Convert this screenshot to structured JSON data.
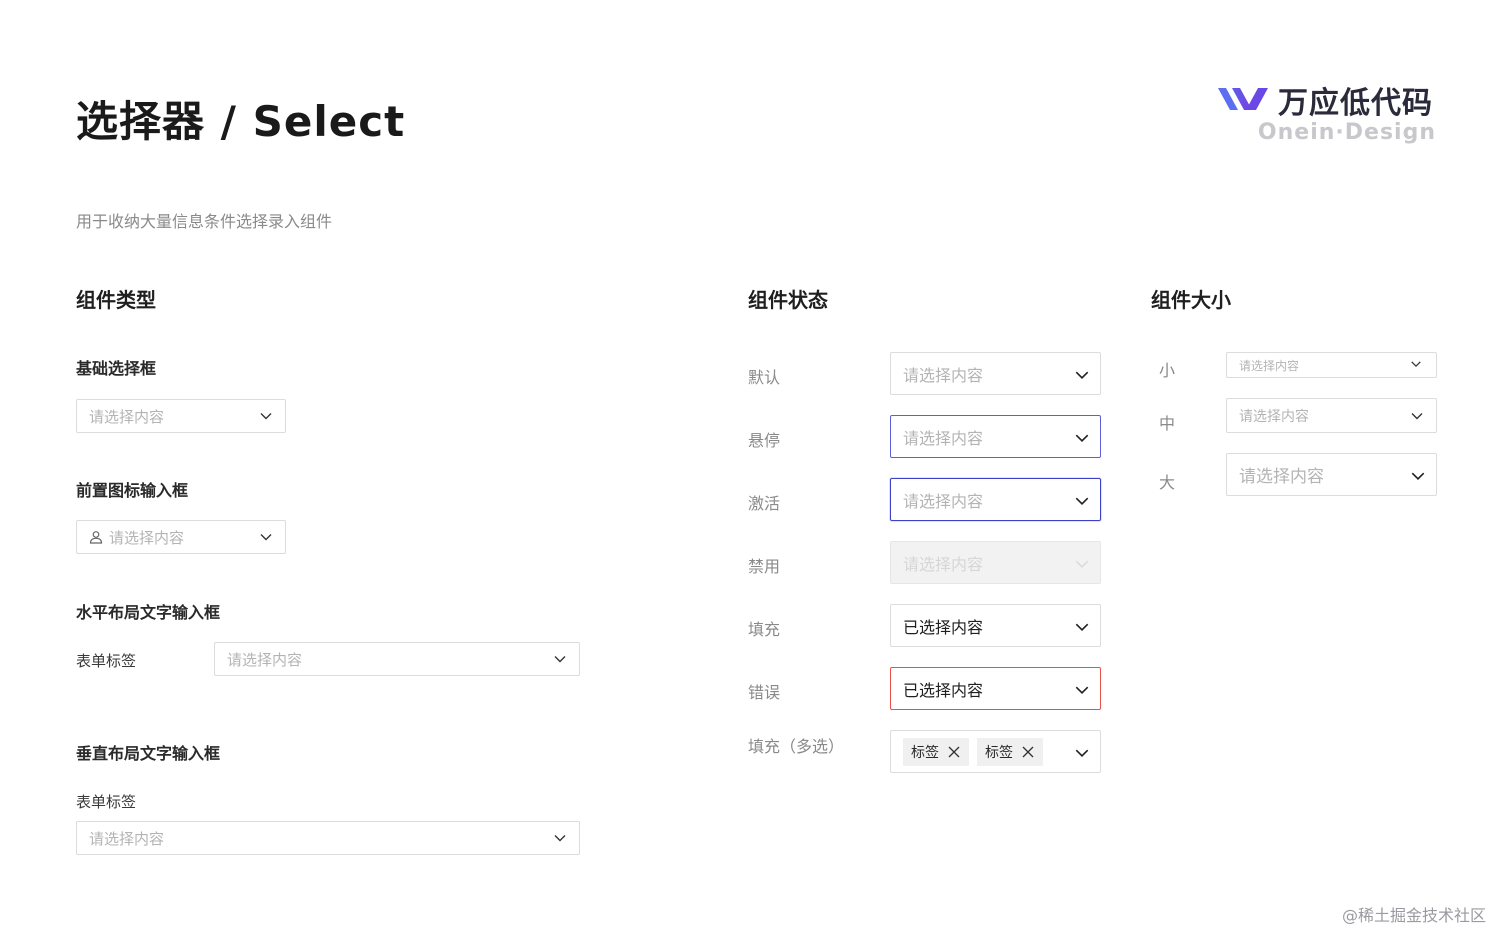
{
  "header": {
    "title": "选择器 / Select",
    "subtitle": "用于收纳大量信息条件选择录入组件"
  },
  "logo": {
    "name": "万应低代码",
    "sub": "Onein·Design",
    "colors": [
      "#5b5fe8",
      "#7a3fe0"
    ]
  },
  "types": {
    "title": "组件类型",
    "basic": {
      "title": "基础选择框",
      "placeholder": "请选择内容"
    },
    "prefix_icon": {
      "title": "前置图标输入框",
      "placeholder": "请选择内容",
      "icon": "user-icon"
    },
    "horizontal": {
      "title": "水平布局文字输入框",
      "label": "表单标签",
      "placeholder": "请选择内容"
    },
    "vertical": {
      "title": "垂直布局文字输入框",
      "label": "表单标签",
      "placeholder": "请选择内容"
    }
  },
  "states": {
    "title": "组件状态",
    "default": {
      "label": "默认",
      "placeholder": "请选择内容"
    },
    "hover": {
      "label": "悬停",
      "placeholder": "请选择内容"
    },
    "active": {
      "label": "激活",
      "placeholder": "请选择内容"
    },
    "disabled": {
      "label": "禁用",
      "placeholder": "请选择内容"
    },
    "filled": {
      "label": "填充",
      "value": "已选择内容"
    },
    "error": {
      "label": "错误",
      "value": "已选择内容"
    },
    "multi": {
      "label": "填充（多选）",
      "tags": [
        "标签",
        "标签"
      ]
    }
  },
  "sizes": {
    "title": "组件大小",
    "small": {
      "label": "小",
      "placeholder": "请选择内容"
    },
    "medium": {
      "label": "中",
      "placeholder": "请选择内容"
    },
    "large": {
      "label": "大",
      "placeholder": "请选择内容"
    }
  },
  "colors": {
    "hover_border": "#5b5fd8",
    "active_border": "#3d41c8",
    "error_border": "#e8504a",
    "disabled_bg": "#f2f2f2"
  },
  "watermark": "@稀土掘金技术社区"
}
